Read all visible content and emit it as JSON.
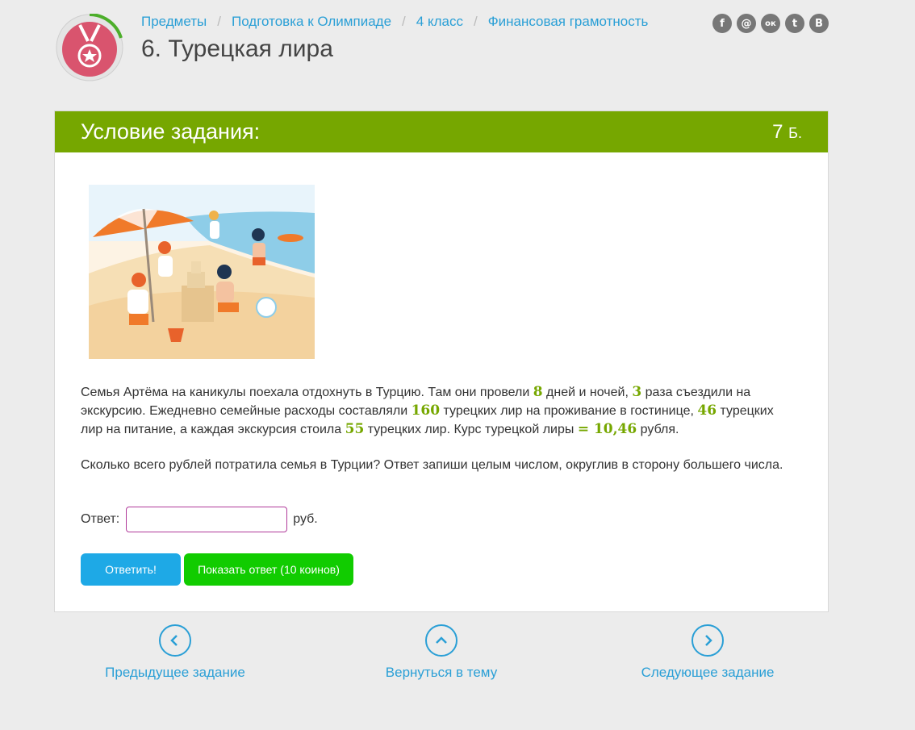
{
  "breadcrumb": [
    {
      "label": "Предметы"
    },
    {
      "label": "Подготовка к Олимпиаде"
    },
    {
      "label": "4 класс"
    },
    {
      "label": "Финансовая грамотность"
    }
  ],
  "page_title": "6. Турецкая лира",
  "social_icons": [
    {
      "name": "facebook-icon",
      "glyph": "f"
    },
    {
      "name": "mail-icon",
      "glyph": "@"
    },
    {
      "name": "odnoklassniki-icon",
      "glyph": "ок"
    },
    {
      "name": "twitter-icon",
      "glyph": "t"
    },
    {
      "name": "vk-icon",
      "glyph": "В"
    }
  ],
  "card": {
    "title": "Условие задания:",
    "points_value": "7",
    "points_unit": "Б."
  },
  "task": {
    "p1_a": "Семья Артёма на каникулы поехала отдохнуть в Турцию. Там они провели ",
    "n_days": "8",
    "p1_b": " дней и ночей, ",
    "n_trips": "3",
    "p1_c": " раза съездили на экскурсию. Ежедневно семейные расходы составляли ",
    "n_hotel": "160",
    "p1_d": " турецких лир на проживание в гостинице, ",
    "n_food": "46",
    "p1_e": " турецких лир на питание, а каждая экскурсия стоила ",
    "n_trip_cost": "55",
    "p1_f": " турецких лир. Курс турецкой лиры ",
    "n_rate": "= 10,46",
    "p1_g": " рубля.",
    "p2": "Сколько всего рублей потратила семья в Турции? Ответ запиши целым числом, округлив в сторону большего числа."
  },
  "answer": {
    "label": "Ответ:",
    "value": "",
    "unit": "руб."
  },
  "buttons": {
    "submit": "Ответить!",
    "show_answer": "Показать ответ (10 коинов)"
  },
  "nav": {
    "prev": "Предыдущее задание",
    "back": "Вернуться в тему",
    "next": "Следующее задание"
  },
  "colors": {
    "accent_green": "#76a700",
    "link_blue": "#2a9fd6",
    "button_blue": "#1ea9e6",
    "button_green": "#11cc00"
  }
}
